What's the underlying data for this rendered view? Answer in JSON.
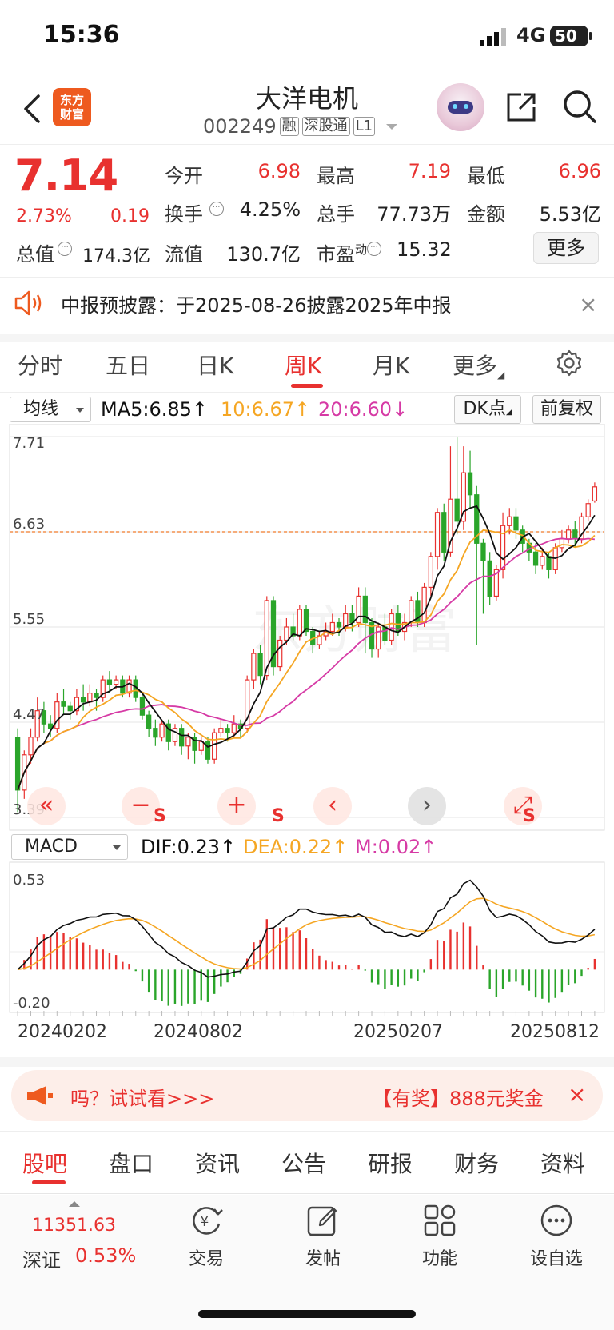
{
  "status": {
    "time": "15:36",
    "network": "4G",
    "battery": "50"
  },
  "header": {
    "logo": "东方\n财富",
    "name": "大洋电机",
    "code": "002249",
    "tags": [
      "融",
      "深股通",
      "L1"
    ]
  },
  "quote": {
    "price": "7.14",
    "pct": "2.73%",
    "change": "0.19",
    "open_label": "今开",
    "open": "6.98",
    "high_label": "最高",
    "high": "7.19",
    "low_label": "最低",
    "low": "6.96",
    "turnover_label": "换手",
    "turnover": "4.25%",
    "volume_label": "总手",
    "volume": "77.73万",
    "amount_label": "金额",
    "amount": "5.53亿",
    "mcap_label": "总值",
    "mcap": "174.3亿",
    "float_label": "流值",
    "float": "130.7亿",
    "pe_label": "市盈",
    "pe_sup": "动",
    "pe": "15.32",
    "more": "更多"
  },
  "notice": {
    "text": "中报预披露：于2025-08-26披露2025年中报",
    "close": "×"
  },
  "period_tabs": [
    "分时",
    "五日",
    "日K",
    "周K",
    "月K",
    "更多"
  ],
  "active_period": "周K",
  "chart_controls": {
    "indicator": "均线",
    "ma5": "MA5:6.85↑",
    "ma10": "10:6.67↑",
    "ma20": "20:6.60↓",
    "dk": "DK点",
    "adjust": "前复权"
  },
  "chart_buttons": {
    "left": "«",
    "minus": "−",
    "plus": "+",
    "prev": "‹",
    "next": "›",
    "expand": "⤢",
    "s": "S"
  },
  "macd_controls": {
    "indicator": "MACD",
    "dif": "DIF:0.23↑",
    "dea": "DEA:0.22↑",
    "m": "M:0.02↑"
  },
  "colors": {
    "up": "#e8312f",
    "down": "#2aa52a",
    "ma5": "#111111",
    "ma10": "#f5a623",
    "ma20": "#d63aa5"
  },
  "chart_data": {
    "type": "candlestick",
    "period": "weekly",
    "y_ticks": [
      "7.71",
      "6.63",
      "5.55",
      "4.47",
      "3.39"
    ],
    "ylim": [
      3.39,
      7.71
    ],
    "current_price_line": 6.63,
    "x_labels": [
      "20240202",
      "20240802",
      "20250207",
      "20250812"
    ],
    "candles": [
      [
        4.3,
        3.7,
        4.4,
        3.45
      ],
      [
        3.7,
        4.1,
        4.15,
        3.6
      ],
      [
        4.1,
        4.3,
        4.4,
        4.0
      ],
      [
        4.3,
        4.6,
        4.75,
        4.25
      ],
      [
        4.6,
        4.45,
        4.7,
        4.35
      ],
      [
        4.45,
        4.4,
        4.55,
        4.3
      ],
      [
        4.4,
        4.7,
        4.8,
        4.35
      ],
      [
        4.7,
        4.65,
        4.85,
        4.55
      ],
      [
        4.65,
        4.6,
        4.7,
        4.5
      ],
      [
        4.6,
        4.75,
        4.85,
        4.55
      ],
      [
        4.75,
        4.7,
        4.9,
        4.6
      ],
      [
        4.7,
        4.8,
        4.9,
        4.65
      ],
      [
        4.8,
        4.75,
        4.85,
        4.6
      ],
      [
        4.75,
        4.95,
        5.0,
        4.7
      ],
      [
        4.95,
        4.9,
        5.05,
        4.8
      ],
      [
        4.9,
        4.95,
        5.0,
        4.85
      ],
      [
        4.95,
        4.8,
        5.0,
        4.75
      ],
      [
        4.8,
        4.95,
        5.0,
        4.75
      ],
      [
        4.95,
        4.75,
        5.0,
        4.7
      ],
      [
        4.75,
        4.55,
        4.8,
        4.5
      ],
      [
        4.55,
        4.4,
        4.6,
        4.3
      ],
      [
        4.4,
        4.3,
        4.5,
        4.2
      ],
      [
        4.3,
        4.45,
        4.5,
        4.25
      ],
      [
        4.45,
        4.25,
        4.5,
        4.15
      ],
      [
        4.25,
        4.4,
        4.45,
        4.2
      ],
      [
        4.4,
        4.2,
        4.45,
        4.1
      ],
      [
        4.2,
        4.3,
        4.35,
        4.05
      ],
      [
        4.3,
        4.15,
        4.35,
        4.0
      ],
      [
        4.15,
        4.25,
        4.3,
        4.1
      ],
      [
        4.25,
        4.05,
        4.3,
        4.0
      ],
      [
        4.05,
        4.35,
        4.4,
        4.0
      ],
      [
        4.35,
        4.4,
        4.5,
        4.3
      ],
      [
        4.4,
        4.35,
        4.45,
        4.25
      ],
      [
        4.35,
        4.45,
        4.55,
        4.3
      ],
      [
        4.45,
        4.4,
        4.5,
        4.3
      ],
      [
        4.4,
        4.95,
        5.0,
        4.35
      ],
      [
        4.95,
        5.25,
        5.3,
        4.85
      ],
      [
        5.25,
        5.0,
        5.35,
        4.9
      ],
      [
        5.0,
        5.85,
        5.9,
        4.95
      ],
      [
        5.85,
        5.1,
        5.9,
        5.0
      ],
      [
        5.1,
        5.4,
        5.45,
        5.05
      ],
      [
        5.4,
        5.55,
        5.65,
        5.35
      ],
      [
        5.55,
        5.45,
        5.7,
        5.4
      ],
      [
        5.45,
        5.75,
        5.8,
        5.4
      ],
      [
        5.75,
        5.5,
        5.8,
        5.45
      ],
      [
        5.5,
        5.35,
        5.55,
        5.25
      ],
      [
        5.35,
        5.45,
        5.5,
        5.3
      ],
      [
        5.45,
        5.5,
        5.6,
        5.4
      ],
      [
        5.5,
        5.6,
        5.7,
        5.45
      ],
      [
        5.6,
        5.55,
        5.65,
        5.45
      ],
      [
        5.55,
        5.7,
        5.8,
        5.5
      ],
      [
        5.7,
        5.6,
        5.8,
        5.5
      ],
      [
        5.6,
        5.9,
        6.0,
        5.55
      ],
      [
        5.9,
        5.6,
        6.0,
        5.25
      ],
      [
        5.6,
        5.3,
        5.65,
        5.2
      ],
      [
        5.3,
        5.55,
        5.6,
        5.2
      ],
      [
        5.55,
        5.4,
        5.7,
        5.35
      ],
      [
        5.4,
        5.7,
        5.75,
        5.35
      ],
      [
        5.7,
        5.5,
        5.8,
        5.45
      ],
      [
        5.5,
        5.6,
        5.7,
        5.4
      ],
      [
        5.6,
        5.85,
        5.9,
        5.55
      ],
      [
        5.85,
        5.6,
        5.95,
        5.55
      ],
      [
        5.6,
        6.0,
        6.05,
        5.55
      ],
      [
        6.0,
        6.35,
        6.4,
        5.9
      ],
      [
        6.35,
        6.85,
        6.9,
        6.2
      ],
      [
        6.85,
        6.4,
        6.95,
        6.3
      ],
      [
        6.4,
        7.0,
        7.6,
        6.35
      ],
      [
        7.0,
        6.75,
        7.7,
        6.6
      ],
      [
        6.75,
        7.3,
        7.6,
        6.65
      ],
      [
        7.3,
        7.05,
        7.55,
        6.9
      ],
      [
        7.05,
        6.5,
        7.15,
        5.35
      ],
      [
        6.5,
        6.3,
        6.55,
        5.7
      ],
      [
        6.3,
        5.9,
        6.4,
        5.8
      ],
      [
        5.9,
        6.2,
        6.25,
        5.85
      ],
      [
        6.2,
        6.7,
        6.85,
        6.1
      ],
      [
        6.7,
        6.8,
        6.9,
        6.6
      ],
      [
        6.8,
        6.65,
        6.9,
        6.55
      ],
      [
        6.65,
        6.5,
        6.7,
        6.4
      ],
      [
        6.5,
        6.4,
        6.55,
        6.3
      ],
      [
        6.4,
        6.25,
        6.5,
        6.15
      ],
      [
        6.25,
        6.35,
        6.45,
        6.2
      ],
      [
        6.35,
        6.2,
        6.4,
        6.1
      ],
      [
        6.2,
        6.45,
        6.5,
        6.15
      ],
      [
        6.45,
        6.55,
        6.65,
        6.4
      ],
      [
        6.55,
        6.65,
        6.7,
        6.5
      ],
      [
        6.65,
        6.55,
        6.75,
        6.45
      ],
      [
        6.55,
        6.8,
        6.85,
        6.5
      ],
      [
        6.8,
        6.95,
        7.0,
        6.75
      ],
      [
        6.98,
        7.14,
        7.19,
        6.96
      ]
    ],
    "macd_ticks": [
      "0.53",
      "-0.20"
    ],
    "macd_ylim": [
      -0.2,
      0.53
    ]
  },
  "promo": {
    "left": "吗？试试看>>>",
    "right": "【有奖】888元奖金",
    "close": "×"
  },
  "bottom_tabs": [
    "股吧",
    "盘口",
    "资讯",
    "公告",
    "研报",
    "财务",
    "资料"
  ],
  "dock": {
    "index_value": "11351.63",
    "index_name": "深证",
    "index_pct": "0.53%",
    "items": [
      "交易",
      "发帖",
      "功能",
      "设自选"
    ]
  }
}
